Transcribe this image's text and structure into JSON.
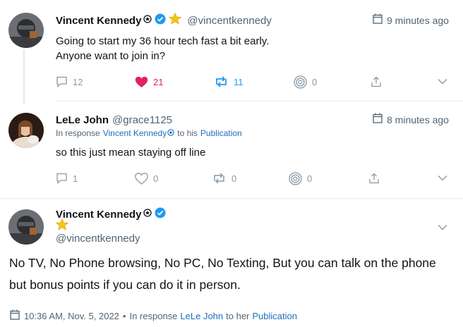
{
  "tweets": [
    {
      "author": "Vincent Kennedy",
      "handle": "@vincentkennedy",
      "time": "9 minutes ago",
      "text_lines": [
        "Going to start my 36 hour tech fast a bit early.",
        "Anyone want to join in?"
      ],
      "replies": "12",
      "likes": "21",
      "reposts": "11",
      "quotes": "0"
    },
    {
      "author": "LeLe John",
      "handle": "@grace1125",
      "time": "8 minutes ago",
      "in_response_prefix": "In response",
      "in_response_user": "Vincent Kennedy",
      "in_response_mid": "to his",
      "in_response_link": "Publication",
      "text": "so this just mean staying off line",
      "replies": "1",
      "likes": "0",
      "reposts": "0",
      "quotes": "0"
    },
    {
      "author": "Vincent Kennedy",
      "handle": "@vincentkennedy",
      "text_lines": [
        "No TV, No Phone browsing, No PC, No Texting, But you can talk on the phone",
        "but bonus points if you can do it in person."
      ],
      "timestamp": "10:36 AM, Nov. 5, 2022",
      "bullet": "•",
      "in_response_prefix": "In response",
      "in_response_user": "LeLe John",
      "in_response_mid": "to her",
      "in_response_link": "Publication"
    }
  ],
  "colors": {
    "like": "#e0245e",
    "repost": "#1d9bf0",
    "verified": "#1d9bf0",
    "link": "#1d6fbb"
  }
}
